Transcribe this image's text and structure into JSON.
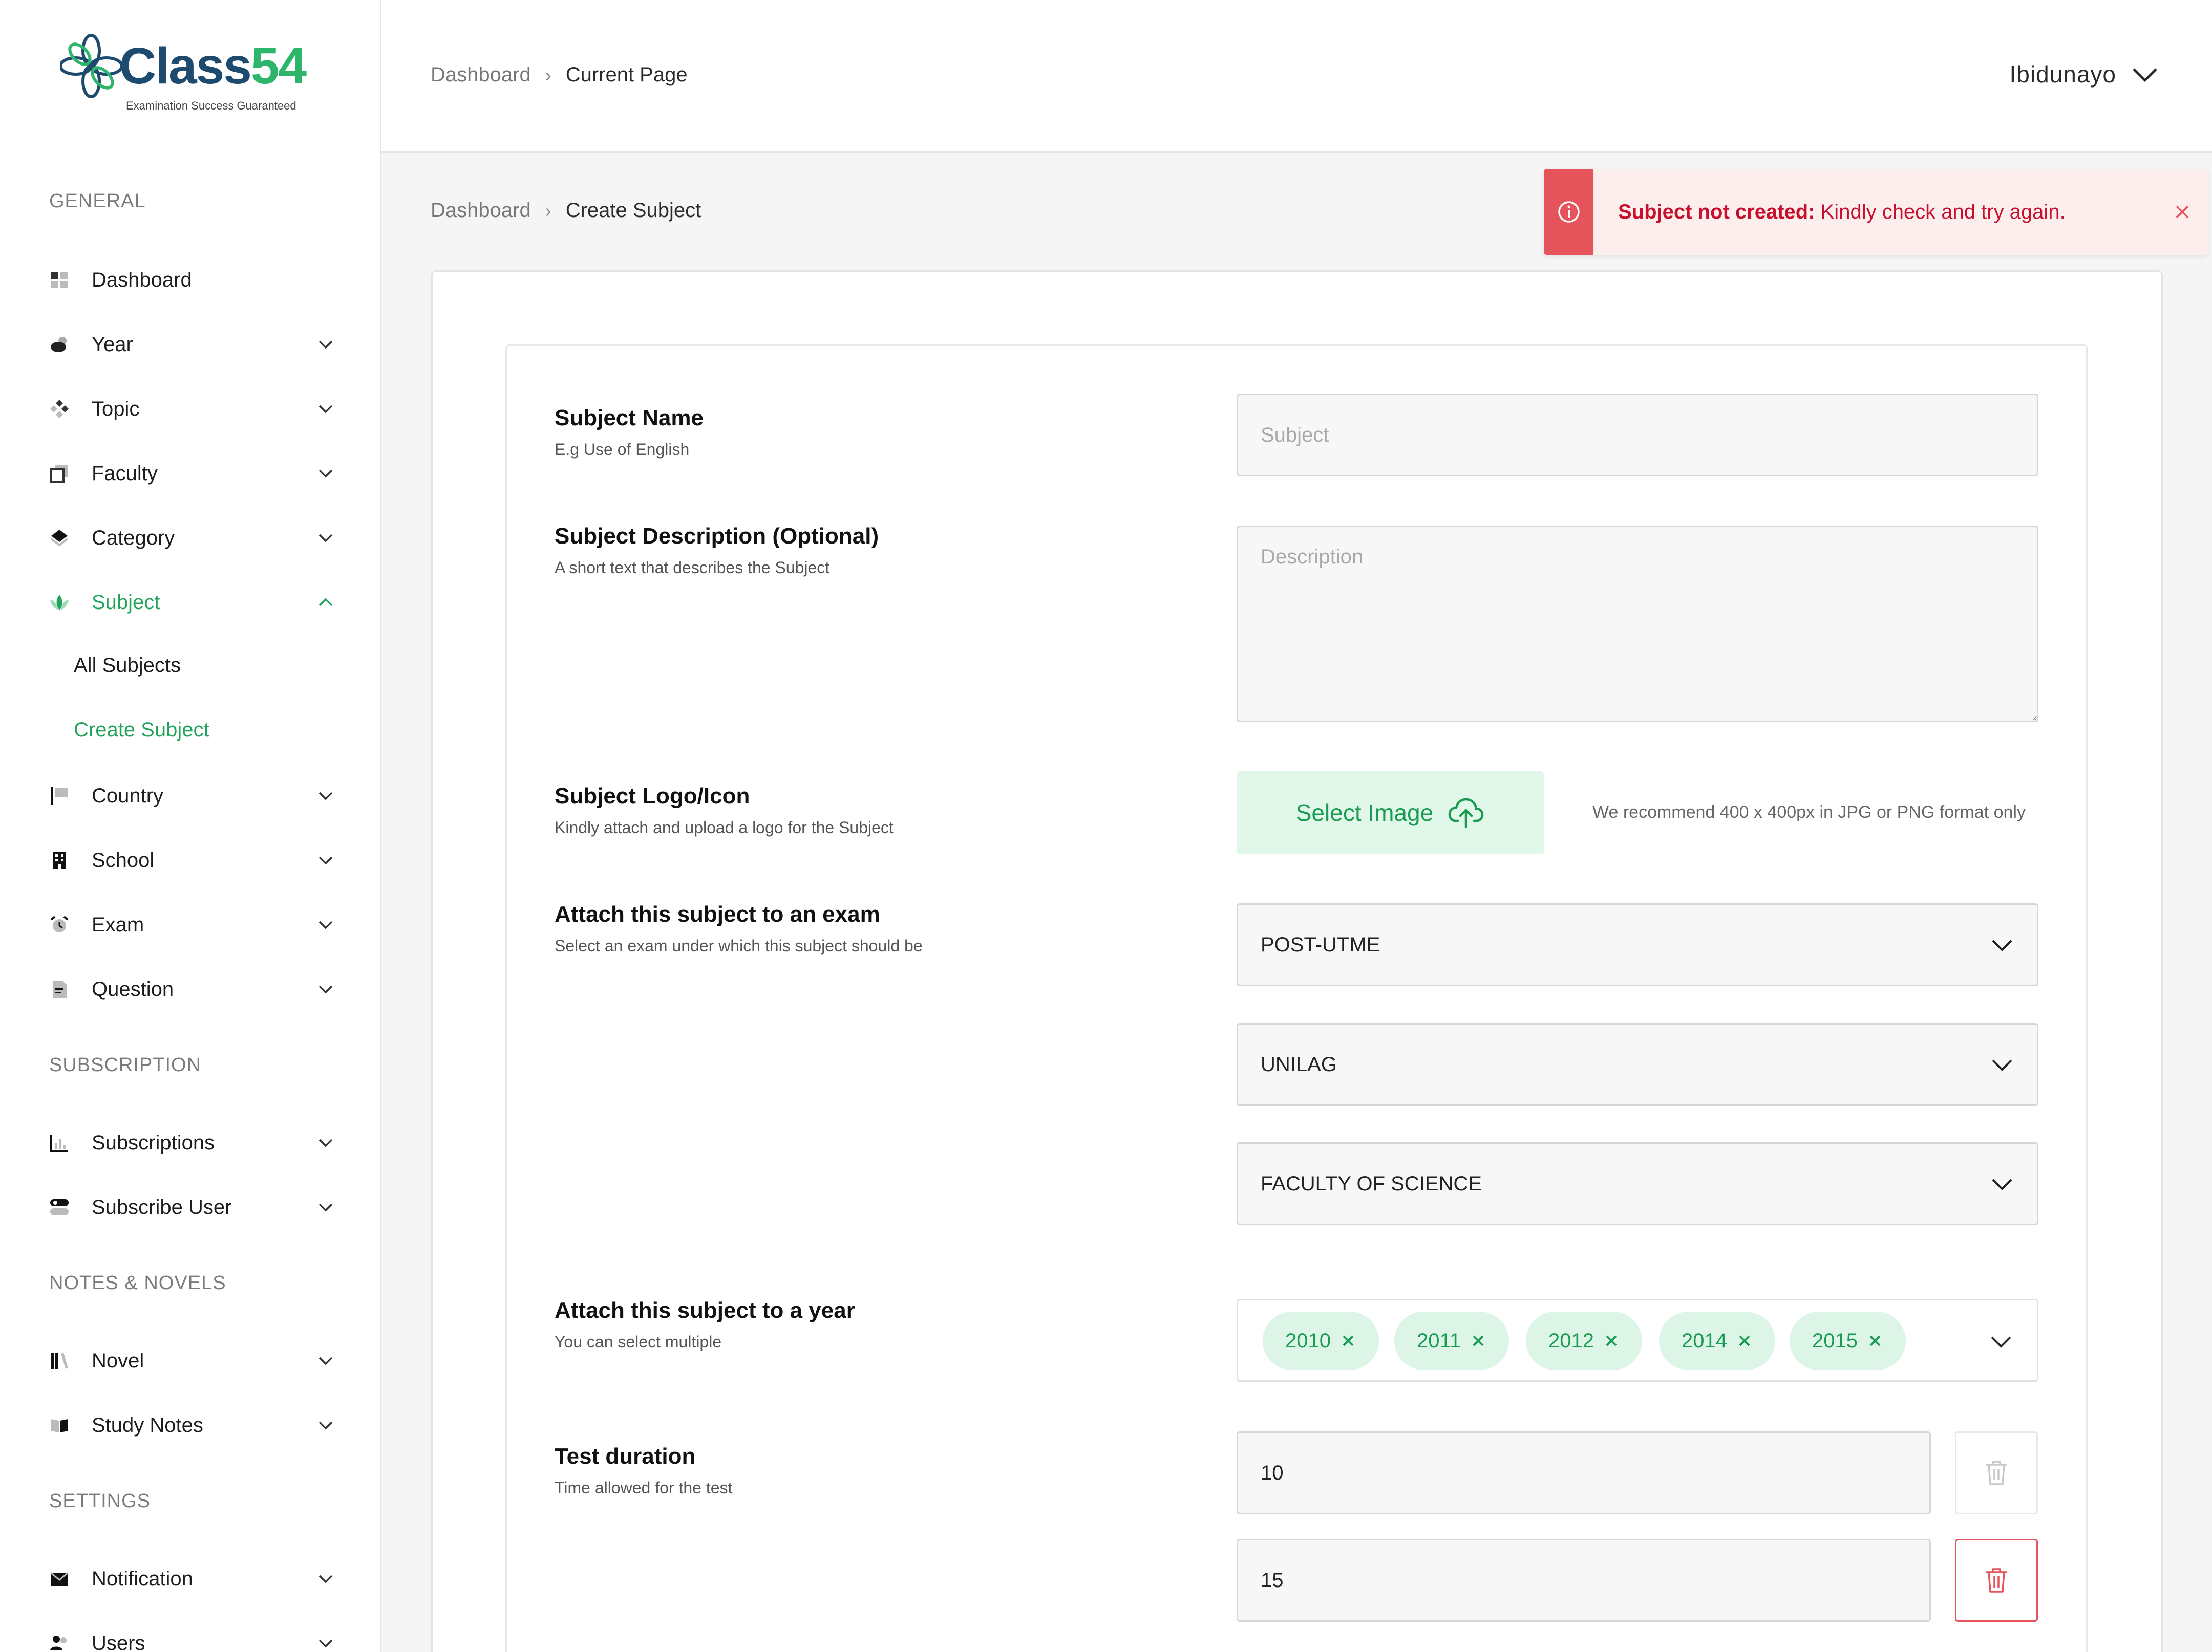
{
  "brand": {
    "name_part1": "Class",
    "name_part2": "54",
    "tagline": "Examination Success Guaranteed"
  },
  "colors": {
    "accent": "#22a45d",
    "error": "#c8102e",
    "error_bar": "#e5545a",
    "tag_bg": "#dcf5e7"
  },
  "sidebar": {
    "sections": {
      "general": "GENERAL",
      "subscription": "SUBSCRIPTION",
      "notes": "NOTES & NOVELS",
      "settings": "SETTINGS"
    },
    "items": {
      "dashboard": "Dashboard",
      "year": "Year",
      "topic": "Topic",
      "faculty": "Faculty",
      "category": "Category",
      "subject": "Subject",
      "country": "Country",
      "school": "School",
      "exam": "Exam",
      "question": "Question",
      "subscriptions": "Subscriptions",
      "subscribe_user": "Subscribe User",
      "novel": "Novel",
      "study_notes": "Study Notes",
      "notification": "Notification",
      "users": "Users"
    },
    "subject_sub": {
      "all": "All Subjects",
      "create": "Create Subject"
    }
  },
  "header": {
    "crumb_root": "Dashboard",
    "crumb_current": "Current Page",
    "user_name": "Ibidunayo"
  },
  "page": {
    "crumb_root": "Dashboard",
    "crumb_current": "Create Subject"
  },
  "toast": {
    "strong": "Subject not created:",
    "message": " Kindly check and try again."
  },
  "form": {
    "name": {
      "title": "Subject Name",
      "hint": "E.g Use of English",
      "placeholder": "Subject",
      "value": ""
    },
    "description": {
      "title": "Subject Description (Optional)",
      "hint": "A short text that describes the Subject",
      "placeholder": "Description"
    },
    "logo": {
      "title": "Subject Logo/Icon",
      "hint": "Kindly attach and upload a logo for the Subject",
      "button": "Select Image",
      "recommend": "We recommend 400 x 400px in JPG or PNG format only"
    },
    "exam": {
      "title": "Attach this subject to an exam",
      "hint": "Select an exam under which this subject should be",
      "exam_value": "POST-UTME",
      "school_value": "UNILAG",
      "faculty_value": "FACULTY OF SCIENCE"
    },
    "year": {
      "title": "Attach this subject to a year",
      "hint": "You can select multiple",
      "tags": [
        "2010",
        "2011",
        "2012",
        "2014",
        "2015"
      ]
    },
    "duration": {
      "title": "Test duration",
      "hint": "Time allowed for the test",
      "values": [
        "10",
        "15"
      ]
    }
  }
}
